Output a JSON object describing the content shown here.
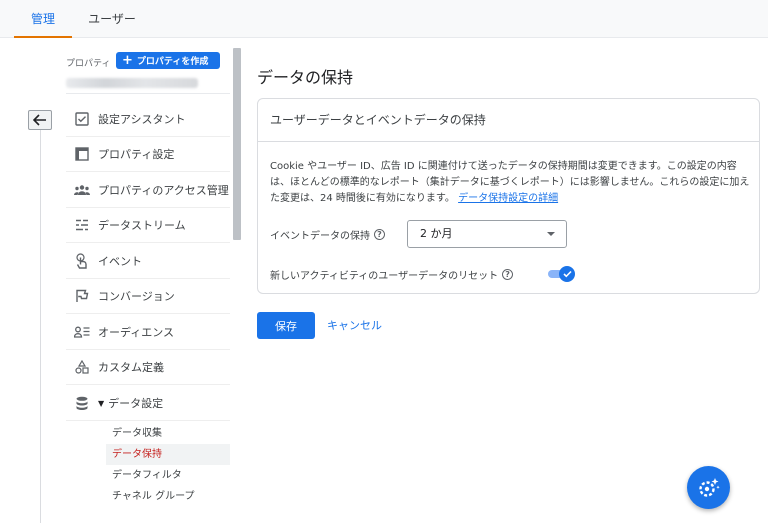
{
  "top_tabs": [
    {
      "label": "管理",
      "active": true
    },
    {
      "label": "ユーザー",
      "active": false
    }
  ],
  "sidebar": {
    "property_label": "プロパティ",
    "create_property_button": "プロパティを作成",
    "items": [
      {
        "label": "設定アシスタント",
        "icon": "checklist-icon"
      },
      {
        "label": "プロパティ設定",
        "icon": "property-settings-icon"
      },
      {
        "label": "プロパティのアクセス管理",
        "icon": "people-icon"
      },
      {
        "label": "データストリーム",
        "icon": "data-stream-icon"
      },
      {
        "label": "イベント",
        "icon": "touch-icon"
      },
      {
        "label": "コンバージョン",
        "icon": "flag-icon"
      },
      {
        "label": "オーディエンス",
        "icon": "audience-icon"
      },
      {
        "label": "カスタム定義",
        "icon": "shapes-icon"
      },
      {
        "label": "データ設定",
        "icon": "database-icon"
      }
    ],
    "sub_items": [
      {
        "label": "データ収集",
        "active": false
      },
      {
        "label": "データ保持",
        "active": true
      },
      {
        "label": "データフィルタ",
        "active": false
      },
      {
        "label": "チャネル グループ",
        "active": false
      }
    ]
  },
  "main": {
    "page_title": "データの保持",
    "card_title": "ユーザーデータとイベントデータの保持",
    "description": "Cookie やユーザー ID、広告 ID に関連付けて送ったデータの保持期間は変更できます。この設定の内容は、ほとんどの標準的なレポート（集計データに基づくレポート）には影響しません。これらの設定に加えた変更は、24 時間後に有効になります。",
    "description_link": "データ保持設定の詳細",
    "event_retention_label": "イベントデータの保持",
    "event_retention_value": "2 か月",
    "reset_label": "新しいアクティビティのユーザーデータのリセット",
    "reset_enabled": true,
    "save_button": "保存",
    "cancel_button": "キャンセル"
  },
  "colors": {
    "accent": "#1a73e8",
    "active_tab_underline": "#e37400",
    "active_sub_item": "#c5221f"
  }
}
